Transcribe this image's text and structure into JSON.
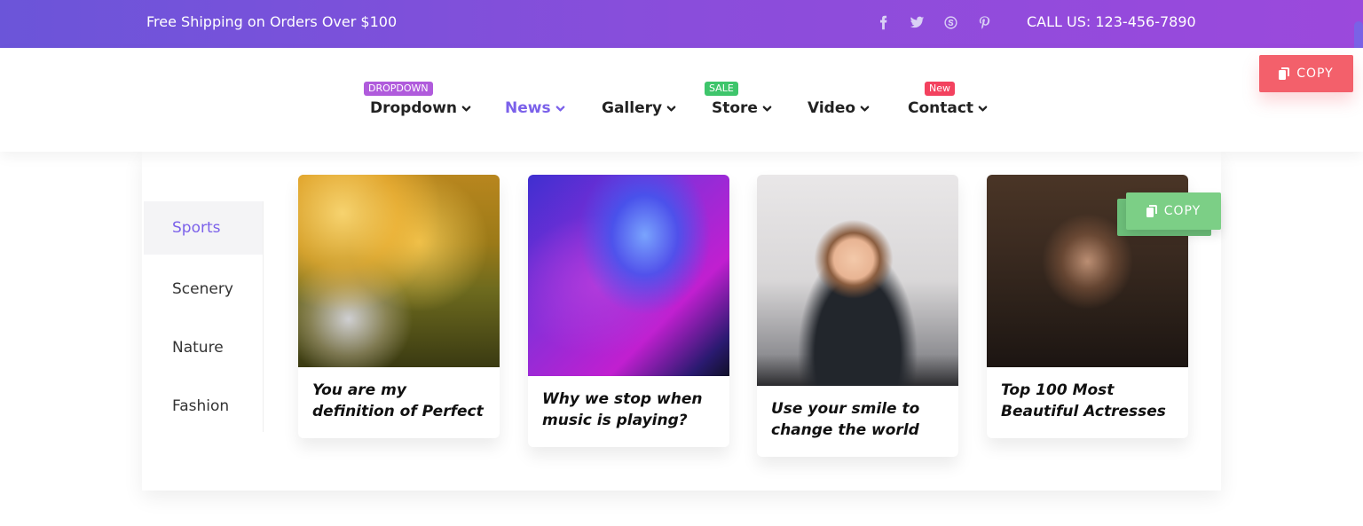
{
  "topbar": {
    "shipping": "Free Shipping on Orders Over $100",
    "social": [
      "facebook-icon",
      "twitter-icon",
      "skype-icon",
      "pinterest-icon"
    ],
    "call": "CALL US: 123-456-7890"
  },
  "nav": {
    "items": [
      {
        "label": "Dropdown",
        "badge": "DROPDOWN",
        "badge_color": "#b05bdc"
      },
      {
        "label": "News",
        "active": true
      },
      {
        "label": "Gallery"
      },
      {
        "label": "Store",
        "badge": "SALE",
        "badge_color": "#3ec56b"
      },
      {
        "label": "Video"
      },
      {
        "label": "Contact",
        "badge": "New",
        "badge_color": "#f3425f"
      }
    ]
  },
  "copy": {
    "label": "COPY"
  },
  "categories": [
    "Sports",
    "Scenery",
    "Nature",
    "Fashion"
  ],
  "cards": [
    {
      "title": "You are my definition of Perfect"
    },
    {
      "title": "Why we stop when music is playing?"
    },
    {
      "title": "Use your smile to change the world"
    },
    {
      "title": "Top 100 Most Beautiful Actresses"
    }
  ],
  "colors": {
    "accent": "#7b61ea",
    "copy_red": "#f3606b",
    "copy_green": "#7ccf86"
  }
}
